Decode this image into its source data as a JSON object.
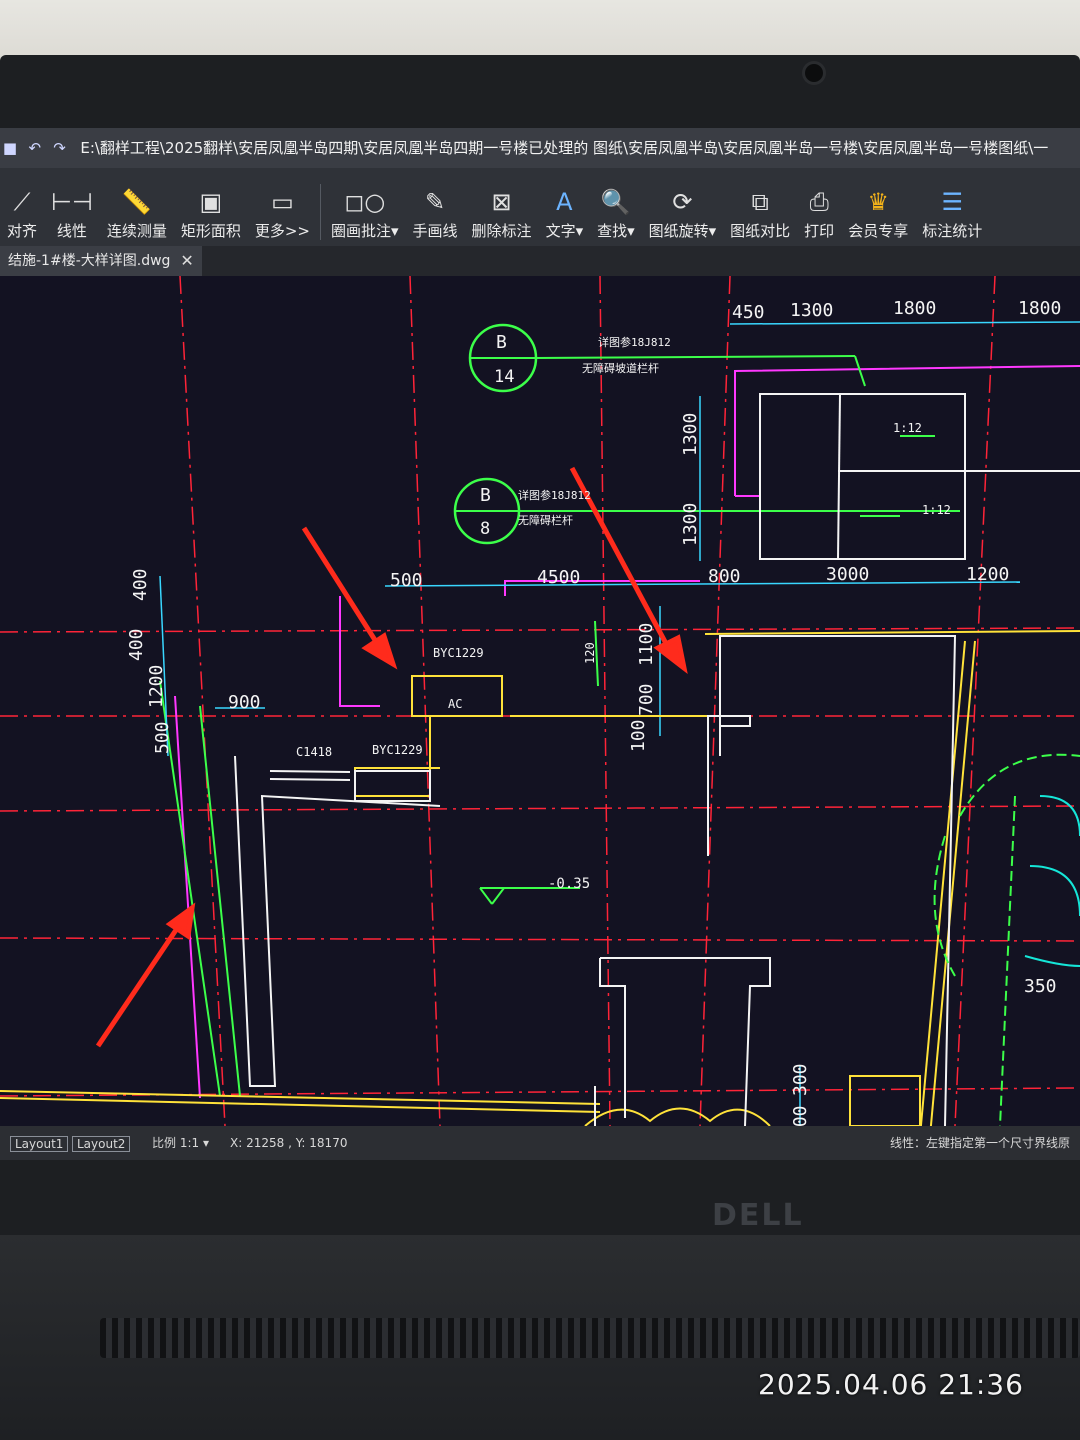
{
  "window": {
    "title_path": "E:\\翻样工程\\2025翻样\\安居凤凰半岛四期\\安居凤凰半岛四期一号楼已处理的 图纸\\安居凤凰半岛\\安居凤凰半岛一号楼\\安居凤凰半岛一号楼图纸\\一"
  },
  "toolbar": {
    "items": [
      {
        "label": "对齐",
        "icon": "align-icon"
      },
      {
        "label": "线性",
        "icon": "linear-dim-icon"
      },
      {
        "label": "连续测量",
        "icon": "ruler-icon"
      },
      {
        "label": "矩形面积",
        "icon": "area-icon"
      },
      {
        "label": "更多>>",
        "icon": "more-icon"
      },
      {
        "label": "圈画批注▾",
        "icon": "circle-annotate-icon"
      },
      {
        "label": "手画线",
        "icon": "pen-icon"
      },
      {
        "label": "删除标注",
        "icon": "delete-dim-icon"
      },
      {
        "label": "文字▾",
        "icon": "text-icon"
      },
      {
        "label": "查找▾",
        "icon": "find-icon"
      },
      {
        "label": "图纸旋转▾",
        "icon": "rotate-90-icon"
      },
      {
        "label": "图纸对比",
        "icon": "compare-icon"
      },
      {
        "label": "打印",
        "icon": "print-icon"
      },
      {
        "label": "会员专享",
        "icon": "vip-crown-icon"
      },
      {
        "label": "标注统计",
        "icon": "stats-icon"
      }
    ]
  },
  "tab": {
    "label": "结施-1#楼-大样详图.dwg",
    "close": "✕"
  },
  "drawing": {
    "dims_top": [
      "450",
      "1300",
      "1800",
      "1800"
    ],
    "dims_mid": [
      "500",
      "4500",
      "800",
      "3000",
      "1200"
    ],
    "dims_vertical": [
      "1300",
      "1300",
      "1100",
      "700",
      "100",
      "400",
      "400",
      "1200",
      "500",
      "300",
      "500"
    ],
    "dim_900": "900",
    "dim_350": "350",
    "labels": [
      "BYC1229",
      "AC",
      "BYC1229",
      "C1418",
      "-0.35",
      "1:12",
      "1:12",
      "120"
    ],
    "callout_1": {
      "top": "B",
      "bottom": "14",
      "note_1": "详图参18J812",
      "note_2": "无障碍坡道栏杆"
    },
    "callout_2": {
      "top": "B",
      "bottom": "8",
      "note_1": "详图参18J812",
      "note_2": "无障碍栏杆"
    }
  },
  "status": {
    "layouts": [
      "Layout1",
      "Layout2"
    ],
    "scale": "比例 1:1 ▾",
    "coords": "X: 21258 , Y: 18170",
    "hint": "线性：左键指定第一个尺寸界线原"
  },
  "hardware": {
    "brand": "DELL"
  },
  "photo": {
    "timestamp": "2025.04.06  21:36"
  },
  "colors": {
    "accent_red": "#ff2b1c",
    "cad_yellow": "#ffe23a",
    "cad_green": "#3cff4a",
    "cad_magenta": "#ff38ff"
  }
}
